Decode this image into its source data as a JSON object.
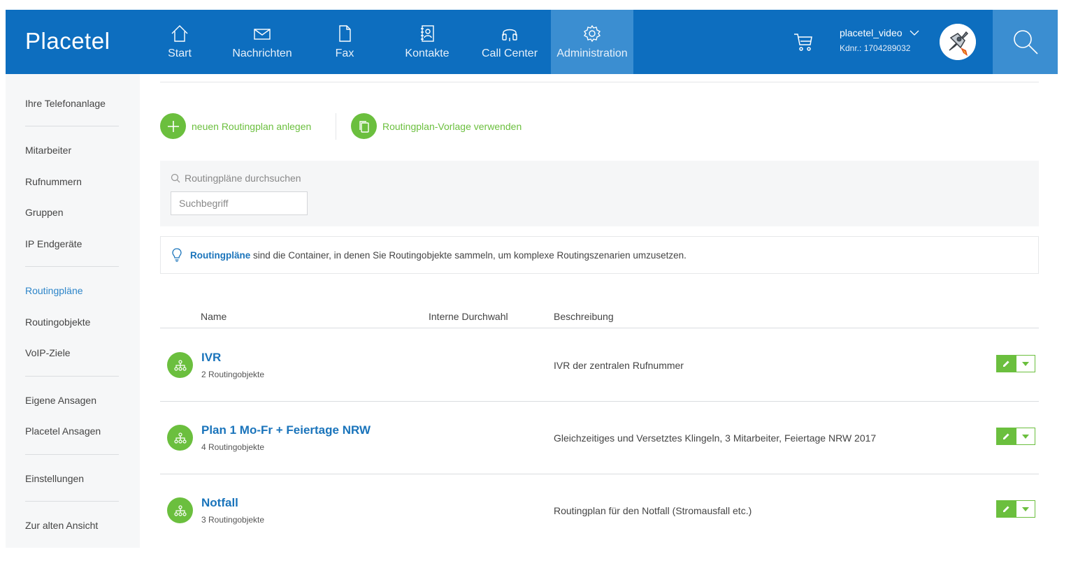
{
  "app": {
    "logo": "Placetel"
  },
  "nav": {
    "items": [
      {
        "label": "Start",
        "icon": "home-icon",
        "active": false
      },
      {
        "label": "Nachrichten",
        "icon": "envelope-icon",
        "active": false
      },
      {
        "label": "Fax",
        "icon": "document-icon",
        "active": false
      },
      {
        "label": "Kontakte",
        "icon": "contacts-icon",
        "active": false
      },
      {
        "label": "Call Center",
        "icon": "headset-icon",
        "active": false
      },
      {
        "label": "Administration",
        "icon": "gear-icon",
        "active": true
      }
    ]
  },
  "user": {
    "name": "placetel_video",
    "customer_no": "Kdnr.: 1704289032"
  },
  "sidebar": {
    "items": [
      {
        "label": "Ihre Telefonanlage"
      },
      {
        "label": "Mitarbeiter"
      },
      {
        "label": "Rufnummern"
      },
      {
        "label": "Gruppen"
      },
      {
        "label": "IP Endgeräte"
      },
      {
        "label": "Routingpläne",
        "active": true
      },
      {
        "label": "Routingobjekte"
      },
      {
        "label": "VoIP-Ziele"
      },
      {
        "label": "Eigene Ansagen"
      },
      {
        "label": "Placetel Ansagen"
      },
      {
        "label": "Einstellungen"
      },
      {
        "label": "Zur alten Ansicht"
      }
    ]
  },
  "actions": {
    "new_plan": "neuen Routingplan anlegen",
    "use_template": "Routingplan-Vorlage verwenden"
  },
  "search": {
    "title": "Routingpläne durchsuchen",
    "placeholder": "Suchbegriff"
  },
  "info": {
    "link": "Routingpläne",
    "text": "sind die Container, in denen Sie Routingobjekte sammeln, um komplexe Routingszenarien umzusetzen."
  },
  "table": {
    "columns": {
      "name": "Name",
      "extension": "Interne Durchwahl",
      "description": "Beschreibung"
    },
    "rows": [
      {
        "name": "IVR",
        "sub": "2 Routingobjekte",
        "extension": "",
        "description": "IVR der zentralen Rufnummer"
      },
      {
        "name": "Plan 1 Mo-Fr + Feiertage NRW",
        "sub": "4 Routingobjekte",
        "extension": "",
        "description": "Gleichzeitiges und Versetztes Klingeln, 3 Mitarbeiter, Feiertage NRW 2017"
      },
      {
        "name": "Notfall",
        "sub": "3 Routingobjekte",
        "extension": "",
        "description": "Routingplan für den Notfall (Stromausfall etc.)"
      }
    ]
  },
  "colors": {
    "brand_blue": "#0d6ebf",
    "nav_active": "#3b8ed1",
    "accent_green": "#6bbf3e",
    "link_blue": "#1a74bb"
  }
}
